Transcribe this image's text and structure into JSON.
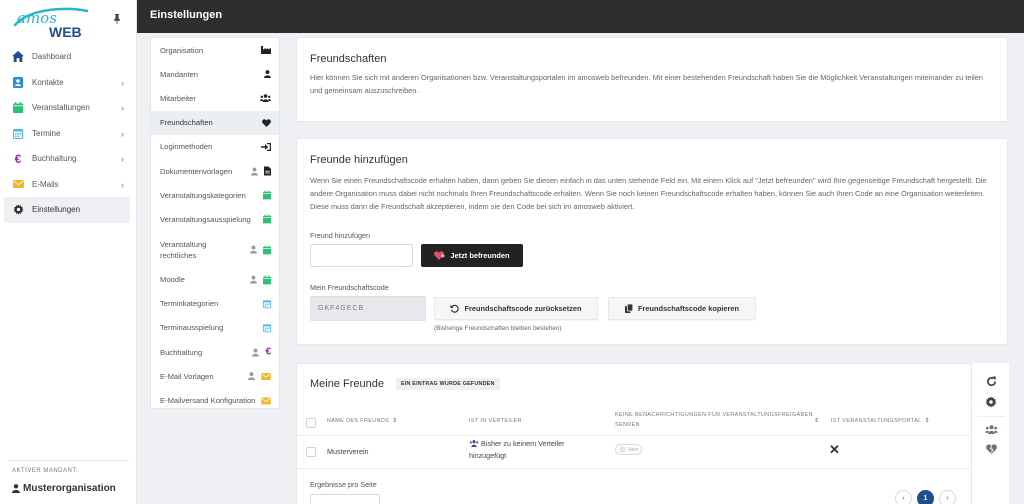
{
  "app": {
    "logo_text_top": "amos",
    "logo_text_bottom": "WEB"
  },
  "sidebar": {
    "items": [
      {
        "label": "Dashboard",
        "icon": "home-icon",
        "color": "#1f4e8c",
        "chevron": false
      },
      {
        "label": "Kontakte",
        "icon": "contact-card-icon",
        "color": "#2d8fd6",
        "chevron": true
      },
      {
        "label": "Veranstaltungen",
        "icon": "calendar-icon",
        "color": "#2ebf7a",
        "chevron": true
      },
      {
        "label": "Termine",
        "icon": "calendar-grid-icon",
        "color": "#4cb8e6",
        "chevron": true
      },
      {
        "label": "Buchhaltung",
        "icon": "euro-icon",
        "color": "#9b27af",
        "chevron": true
      },
      {
        "label": "E-Mails",
        "icon": "envelope-icon",
        "color": "#f2b632",
        "chevron": true
      },
      {
        "label": "Einstellungen",
        "icon": "gear-icon",
        "color": "#333333",
        "chevron": false,
        "active": true
      }
    ],
    "mandant_label": "AKTIVER MANDANT:",
    "mandant_value": "Musterorganisation"
  },
  "topbar": {
    "title": "Einstellungen"
  },
  "submenu": {
    "items": [
      {
        "label": "Organisation",
        "icons": [
          "factory-icon"
        ]
      },
      {
        "label": "Mandanten",
        "icons": [
          "user-icon"
        ]
      },
      {
        "label": "Mitarbeiter",
        "icons": [
          "users-icon"
        ]
      },
      {
        "label": "Freundschaften",
        "icons": [
          "heart-icon"
        ],
        "active": true
      },
      {
        "label": "Loginmethoden",
        "icons": [
          "sign-in-icon"
        ]
      },
      {
        "label": "Dokumentenvorlagen",
        "icons": [
          "user-icon",
          "document-icon"
        ]
      },
      {
        "label": "Veranstaltungskategorien",
        "icons": [
          "calendar-icon"
        ]
      },
      {
        "label": "Veranstaltungsausspielung",
        "icons": [
          "calendar-icon"
        ]
      },
      {
        "label": "Veranstaltung rechtliches",
        "icons": [
          "user-icon",
          "calendar-icon"
        ],
        "tall": true
      },
      {
        "label": "Moodle",
        "icons": [
          "user-icon",
          "calendar-icon"
        ]
      },
      {
        "label": "Terminkategorien",
        "icons": [
          "calendar-grid-icon"
        ]
      },
      {
        "label": "Terminausspielung",
        "icons": [
          "calendar-grid-icon"
        ]
      },
      {
        "label": "Buchhaltung",
        "icons": [
          "user-icon",
          "euro-icon"
        ]
      },
      {
        "label": "E-Mail Vorlagen",
        "icons": [
          "user-icon",
          "envelope-icon"
        ]
      },
      {
        "label": "E-Mailversand Konfiguration",
        "icons": [
          "envelope-icon"
        ]
      }
    ]
  },
  "friendships": {
    "title": "Freundschaften",
    "text": "Hier können Sie sich mit anderen Organisationen bzw. Veranstaltungsportalen im amosweb befreunden. Mit einer bestehenden Freundschaft haben Sie die Möglichkeit Veranstaltungen miteinander zu teilen und gemeinsam auszuschreiben."
  },
  "add_friends": {
    "title": "Freunde hinzufügen",
    "text": "Wenn Sie einen Freundschaftscode erhalten haben, dann geben Sie diesen einfach in das unten stehende Feld ein. Mit einem Klick auf \"Jetzt befreunden\" wird Ihre gegenseitige Freundschaft hergestellt. Die andere Organisation muss dabei nicht nochmals Ihren Freundschaftscode erhalten. Wenn Sie noch keinen Freundschaftscode erhalten haben, können Sie auch Ihren Code an eine Organisation weiterleiten. Diese muss dann die Freundschaft akzeptieren, indem sie den Code bei sich im amosweb aktiviert.",
    "input_label": "Freund hinzufügen",
    "input_value": "",
    "befreunden_label": "Jetzt befreunden",
    "code_label": "Mein Freundschaftscode",
    "code_value": "GKF4GECB",
    "reset_label": "Freundschaftscode zurücksetzen",
    "reset_hint": "(Bisherige Freundschaften bleiben bestehen)",
    "copy_label": "Freundschaftscode kopieren"
  },
  "my_friends": {
    "title": "Meine Freunde",
    "badge": "EIN EINTRAG WURDE GEFUNDEN",
    "columns": [
      "NAME DES FREUNDS",
      "IST IN VERTEILER",
      "KEINE BENACHRICHTIGUNGEN FÜR VERANSTALTUNGSFREIGABEN SENDEN",
      "IST VERANSTALTUNGSPORTAL"
    ],
    "rows": [
      {
        "name": "Musterverein",
        "verteiler": "Bisher zu keinem Verteiler hinzugefügt",
        "toggle_label": "Nein",
        "portal": "✕"
      }
    ],
    "per_page_label": "Ergebnisse pro Seite",
    "current_page": "1",
    "prev": "‹",
    "next": "›"
  }
}
